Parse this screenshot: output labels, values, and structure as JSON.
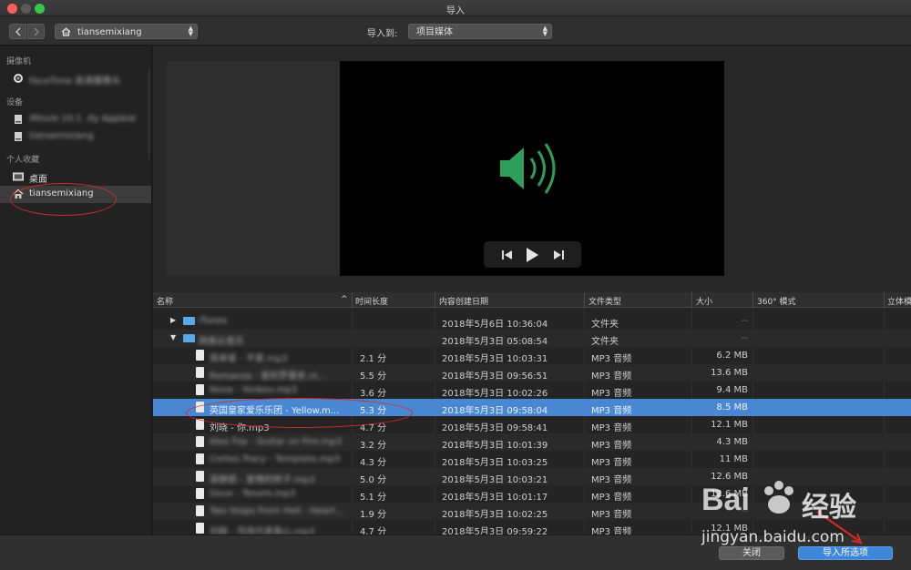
{
  "window": {
    "title": "导入"
  },
  "toolbar": {
    "back_icon": "chevron-left",
    "forward_icon": "chevron-right",
    "location": "tiansemixiang",
    "import_to_label": "导入到:",
    "import_to_value": "项目媒体"
  },
  "sidebar": {
    "sections": [
      {
        "title": "摄像机",
        "items": [
          {
            "label": "FaceTime 高清摄像头",
            "icon": "camera-icon",
            "blurred": true
          }
        ]
      },
      {
        "title": "设备",
        "items": [
          {
            "label": "iMovie 10.1 .dy Applest",
            "icon": "disk-icon",
            "blurred": true
          },
          {
            "label": "tiansemixiang",
            "icon": "disk-icon",
            "blurred": true
          }
        ]
      },
      {
        "title": "个人收藏",
        "items": [
          {
            "label": "桌面",
            "icon": "desktop-icon",
            "blurred": false
          },
          {
            "label": "tiansemixiang",
            "icon": "home-icon",
            "blurred": false,
            "selected": true
          }
        ]
      }
    ]
  },
  "table": {
    "columns": [
      "名称",
      "时间长度",
      "内容创建日期",
      "文件类型",
      "大小",
      "360° 模式",
      "立体模"
    ],
    "sort_indicator": "^",
    "rows": [
      {
        "name": "iTunes",
        "duration": "",
        "date": "2018年5月6日 10:36:04",
        "type": "文件夹",
        "size": "--",
        "kind": "folder",
        "expanded": false,
        "blurred": true
      },
      {
        "name": "网易云音乐",
        "duration": "",
        "date": "2018年5月3日 05:08:54",
        "type": "文件夹",
        "size": "--",
        "kind": "folder",
        "expanded": true,
        "blurred": true
      },
      {
        "name": "简单爱 - 不爱.mp3",
        "duration": "2.1 分",
        "date": "2018年5月3日 10:03:31",
        "type": "MP3 音频",
        "size": "6.2 MB",
        "kind": "file",
        "blurred": true
      },
      {
        "name": "Romanza - 爱的罗曼史.m...",
        "duration": "5.5 分",
        "date": "2018年5月3日 09:56:51",
        "type": "MP3 音频",
        "size": "13.6 MB",
        "kind": "file",
        "blurred": true
      },
      {
        "name": "Nova - Yonkou.mp3",
        "duration": "3.6 分",
        "date": "2018年5月3日 10:02:26",
        "type": "MP3 音频",
        "size": "9.4 MB",
        "kind": "file",
        "blurred": true
      },
      {
        "name": "英国皇家爱乐乐团 - Yellow.m...",
        "duration": "5.3 分",
        "date": "2018年5月3日 09:58:04",
        "type": "MP3 音频",
        "size": "8.5 MB",
        "kind": "file",
        "selected": true,
        "blurred": false
      },
      {
        "name": "刘晓 - 你.mp3",
        "duration": "4.7 分",
        "date": "2018年5月3日 09:58:41",
        "type": "MP3 音频",
        "size": "12.1 MB",
        "kind": "file",
        "blurred": false
      },
      {
        "name": "Alex Fox - Guitar on Fire.mp3",
        "duration": "3.2 分",
        "date": "2018年5月3日 10:01:39",
        "type": "MP3 音频",
        "size": "4.3 MB",
        "kind": "file",
        "blurred": true
      },
      {
        "name": "Cortez,Tracy - Template.mp3",
        "duration": "4.3 分",
        "date": "2018年5月3日 10:03:25",
        "type": "MP3 音频",
        "size": "11 MB",
        "kind": "file",
        "blurred": true
      },
      {
        "name": "梁静茹 - 爱情的样子.mp3",
        "duration": "5.0 分",
        "date": "2018年5月3日 10:03:21",
        "type": "MP3 音频",
        "size": "12.6 MB",
        "kind": "file",
        "blurred": true
      },
      {
        "name": "Dove - Tenero.mp3",
        "duration": "5.1 分",
        "date": "2018年5月3日 10:01:17",
        "type": "MP3 音频",
        "size": "12.6 MB",
        "kind": "file",
        "blurred": true
      },
      {
        "name": "Two Steps From Hell - Heart...",
        "duration": "1.9 分",
        "date": "2018年5月3日 10:02:25",
        "type": "MP3 音频",
        "size": "--",
        "kind": "file",
        "blurred": true
      },
      {
        "name": "刘晓 - 月亮代表我心.mp3",
        "duration": "4.7 分",
        "date": "2018年5月3日 09:59:22",
        "type": "MP3 音频",
        "size": "12.1 MB",
        "kind": "file",
        "blurred": true
      }
    ]
  },
  "buttons": {
    "close": "关闭",
    "import_selected": "导入所选项"
  },
  "watermark": {
    "brand": "Bai",
    "brand_cn": "经验",
    "url": "jingyan.baidu.com"
  },
  "colors": {
    "selection": "#4a87d3",
    "annotation": "#d62a2a",
    "speaker": "#2f9e5b",
    "primary_button": "#3d86da"
  }
}
